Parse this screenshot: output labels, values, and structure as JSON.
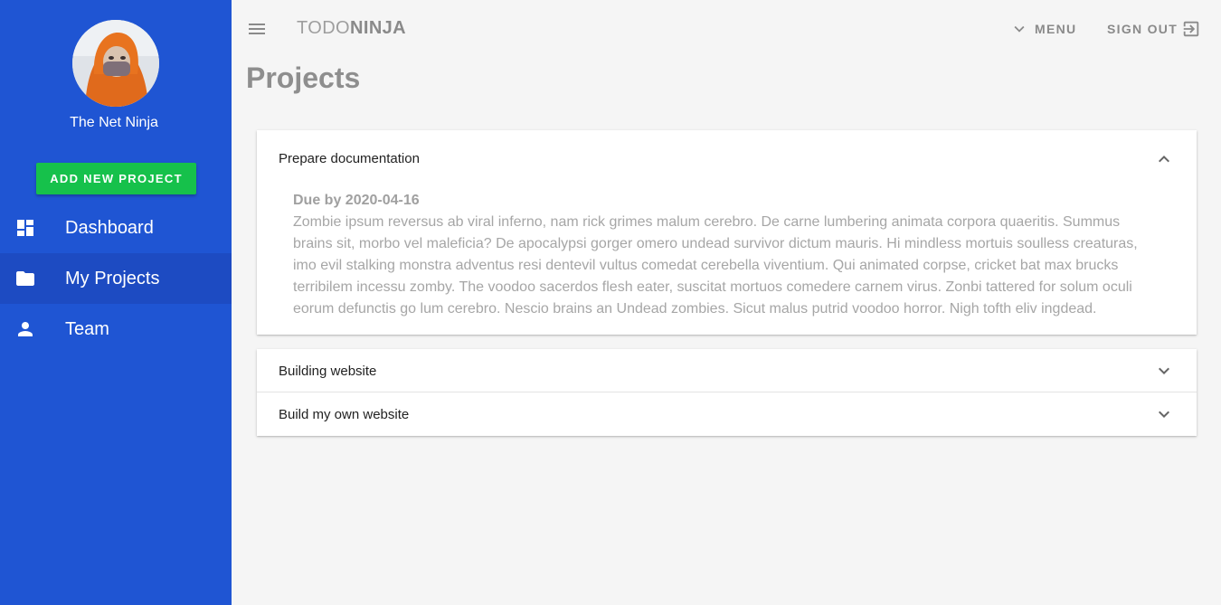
{
  "sidebar": {
    "user_name": "The Net Ninja",
    "add_button_label": "ADD NEW PROJECT",
    "items": [
      {
        "label": "Dashboard",
        "icon": "dashboard-icon"
      },
      {
        "label": "My Projects",
        "icon": "folder-icon",
        "active": true
      },
      {
        "label": "Team",
        "icon": "person-icon"
      }
    ],
    "background": "#1f55d3",
    "accent": "#16c14b"
  },
  "toolbar": {
    "brand_light": "TODO",
    "brand_bold": "NINJA",
    "menu_label": "MENU",
    "signout_label": "SIGN OUT"
  },
  "page": {
    "title": "Projects"
  },
  "projects": [
    {
      "title": "Prepare documentation",
      "expanded": true,
      "due": "Due by 2020-04-16",
      "content": "Zombie ipsum reversus ab viral inferno, nam rick grimes malum cerebro. De carne lumbering animata corpora quaeritis. Summus brains sit, morbo vel maleficia? De apocalypsi gorger omero undead survivor dictum mauris. Hi mindless mortuis soulless creaturas, imo evil stalking monstra adventus resi dentevil vultus comedat cerebella viventium. Qui animated corpse, cricket bat max brucks terribilem incessu zomby. The voodoo sacerdos flesh eater, suscitat mortuos comedere carnem virus. Zonbi tattered for solum oculi eorum defunctis go lum cerebro. Nescio brains an Undead zombies. Sicut malus putrid voodoo horror. Nigh tofth eliv ingdead."
    },
    {
      "title": "Building website",
      "expanded": false
    },
    {
      "title": "Build my own website",
      "expanded": false
    }
  ]
}
